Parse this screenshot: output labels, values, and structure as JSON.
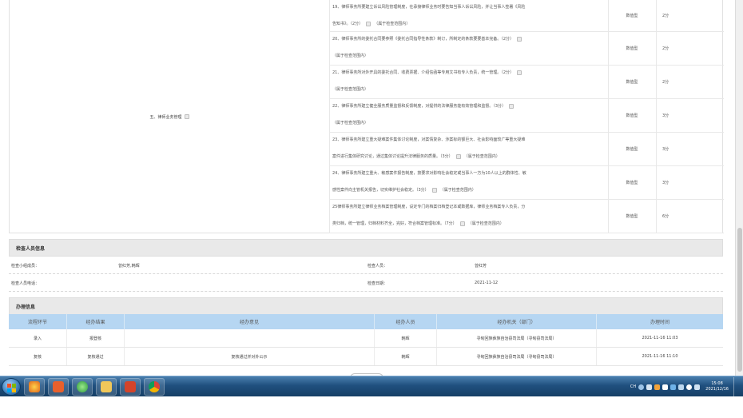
{
  "category": {
    "label": "五、律师业务管理"
  },
  "check_rows": [
    {
      "line1": "19、律师事务所要建立诉讼风险管理制度，在承接律师业务时要告知当事人诉讼风险，并让当事人签署《风险",
      "line2": "告知书》。（2分）",
      "scope": "（属于检查范围内）",
      "type": "数值型",
      "score": "2分"
    },
    {
      "line1": "20、律师事务所的委托合同要参照《委托合同指导性条款》制订，所制定的条款要要基本完备。（2分）",
      "line2": "",
      "scope": "（属于检查范围内）",
      "type": "数值型",
      "score": "2分"
    },
    {
      "line1": "21、律师事务所对外开具的委托合同、收费票据、介绍信函等专用文书有专人负责，统一管理。（2分）",
      "line2": "",
      "scope": "（属于检查范围内）",
      "type": "数值型",
      "score": "2分"
    },
    {
      "line1": "22、律师事务所建立健全服务质量监督和反馈制度，对提供的法律服务能有效管理和监督。（3分）",
      "line2": "",
      "scope": "（属于检查范围内）",
      "type": "数值型",
      "score": "3分"
    },
    {
      "line1": "23、律师事务所建立重大疑难案件集体讨论制度，对案情复杂、涉案标的额巨大、社会影响面较广等重大疑难",
      "line2": "案件进行集体研究讨论，通过集体讨论提升法律服务的质量。（3分）",
      "scope": "（属于检查范围内）",
      "type": "数值型",
      "score": "3分"
    },
    {
      "line1": "24、律师事务所建立重大、敏感案件报告制度，按要求对影响社会稳定或当事人一方为10人以上的群体性、敏",
      "line2": "感性案件向主管机关报告，切实维护社会稳定。（3分）",
      "scope": "（属于检查范围内）",
      "type": "数值型",
      "score": "3分"
    },
    {
      "line1": "25律师事务所建立律师业务档案管理制度，设定专门的档案归档登记本或数据库，律师业务档案专人负责，分",
      "line2": "类归档，统一管理，归档材料齐全，完好，符合档案管理标准。（7分）",
      "scope": "（属于检查范围内）",
      "type": "数值型",
      "score": "6分"
    }
  ],
  "inspector": {
    "header": "检查人员信息",
    "group_label": "检查小组成员：",
    "group_value": "曾红芳,韩辉",
    "inspector_label": "检查人员：",
    "inspector_value": "曾红芳",
    "phone_label": "检查人员电话：",
    "phone_value": "",
    "date_label": "检查日期：",
    "date_value": "2021-11-12"
  },
  "processing": {
    "header": "办理信息",
    "columns": [
      "流程环节",
      "经办结果",
      "经办意见",
      "经办人员",
      "经办机关（部门）",
      "办理时间"
    ],
    "rows": [
      [
        "录入",
        "报登核",
        "",
        "韩辉",
        "寻甸回族彝族自治县司法局（寻甸县司法局）",
        "2021-11-16 11:03"
      ],
      [
        "复核",
        "复核通过",
        "复核通过并对外公示",
        "韩辉",
        "寻甸回族彝族自治县司法局（寻甸县司法局）",
        "2021-11-16 11:10"
      ]
    ]
  },
  "taskbar": {
    "apps": [
      "ie-icon",
      "ppt-icon",
      "browser-icon",
      "explorer-folder-icon",
      "presentation-icon",
      "chrome-icon"
    ],
    "tray_lang": "CH",
    "time": "15:08",
    "date": "2021/12/16"
  },
  "colors": {
    "table_header_bg": "#b6d6f2",
    "section_header_bg": "#e9e9e9",
    "taskbar_top": "#4a7fae",
    "taskbar_bottom": "#163f66"
  }
}
